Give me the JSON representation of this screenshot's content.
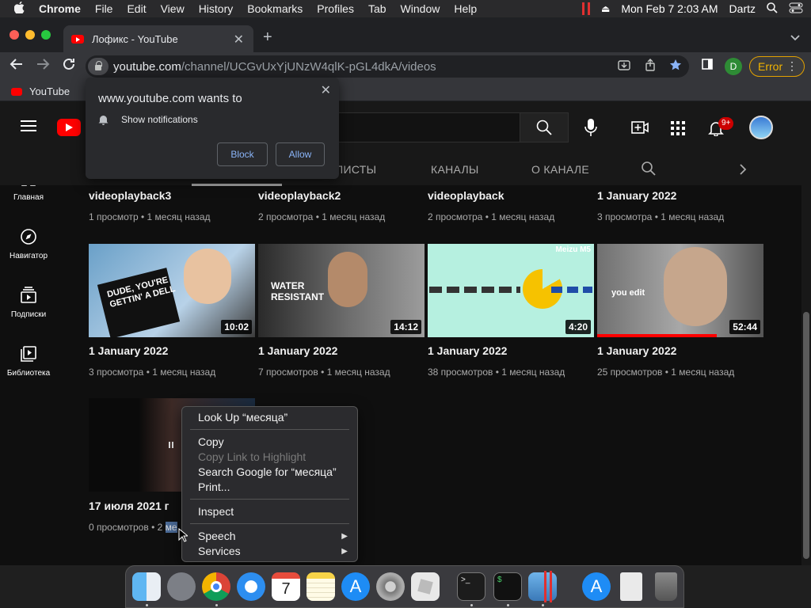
{
  "menubar": {
    "items": [
      "Chrome",
      "File",
      "Edit",
      "View",
      "History",
      "Bookmarks",
      "Profiles",
      "Tab",
      "Window",
      "Help"
    ],
    "datetime": "Mon Feb 7  2:03 AM",
    "user": "Dartz"
  },
  "browser": {
    "tab_title": "Лофикс - YouTube",
    "url_host": "youtube.com",
    "url_path": "/channel/UCGvUxYjUNzW4qlK-pGL4dkA/videos",
    "profile_initial": "D",
    "error_label": "Error",
    "bookmark_label": "YouTube"
  },
  "popup": {
    "title": "www.youtube.com wants to",
    "permission": "Show notifications",
    "block_label": "Block",
    "allow_label": "Allow"
  },
  "youtube": {
    "notif_count": "9+",
    "tabs": [
      "ЛИСТЫ",
      "КАНАЛЫ",
      "О КАНАЛЕ"
    ],
    "sidebar": [
      {
        "label": "Главная",
        "icon": "home-icon"
      },
      {
        "label": "Навигатор",
        "icon": "compass-icon"
      },
      {
        "label": "Подписки",
        "icon": "subscriptions-icon"
      },
      {
        "label": "Библиотека",
        "icon": "library-icon"
      }
    ],
    "row1": [
      {
        "title": "videoplayback3",
        "meta": "1 просмотр • 1 месяц назад"
      },
      {
        "title": "videoplayback2",
        "meta": "2 просмотра • 1 месяц назад"
      },
      {
        "title": "videoplayback",
        "meta": "2 просмотра • 1 месяц назад"
      },
      {
        "title": "1 January 2022",
        "meta": "3 просмотра • 1 месяц назад"
      }
    ],
    "row2": [
      {
        "title": "1 January 2022",
        "meta": "3 просмотра • 1 месяц назад",
        "duration": "10:02",
        "thumb_text": "DUDE, YOU'RE GETTIN' A DELL"
      },
      {
        "title": "1 January 2022",
        "meta": "7 просмотров • 1 месяц назад",
        "duration": "14:12",
        "thumb_text": "WATER RESISTANT"
      },
      {
        "title": "1 January 2022",
        "meta": "38 просмотров • 1 месяц назад",
        "duration": "4:20",
        "thumb_text": "Meizu M5"
      },
      {
        "title": "1 January 2022",
        "meta": "25 просмотров • 1 месяц назад",
        "duration": "52:44",
        "thumb_text": "you edit",
        "watched": 0.72
      }
    ],
    "row3": [
      {
        "title": "17 июля 2021 г",
        "meta_prefix": "0 просмотров • 2 ",
        "meta_highlight": "ме"
      }
    ]
  },
  "context_menu": {
    "lookup": "Look Up “месяца”",
    "copy": "Copy",
    "copy_link": "Copy Link to Highlight",
    "search_google": "Search Google for “месяца”",
    "print": "Print...",
    "inspect": "Inspect",
    "speech": "Speech",
    "services": "Services"
  },
  "colors": {
    "youtube_red": "#ff0000",
    "error_amber": "#f2b400",
    "link_blue": "#8ab4f8"
  }
}
